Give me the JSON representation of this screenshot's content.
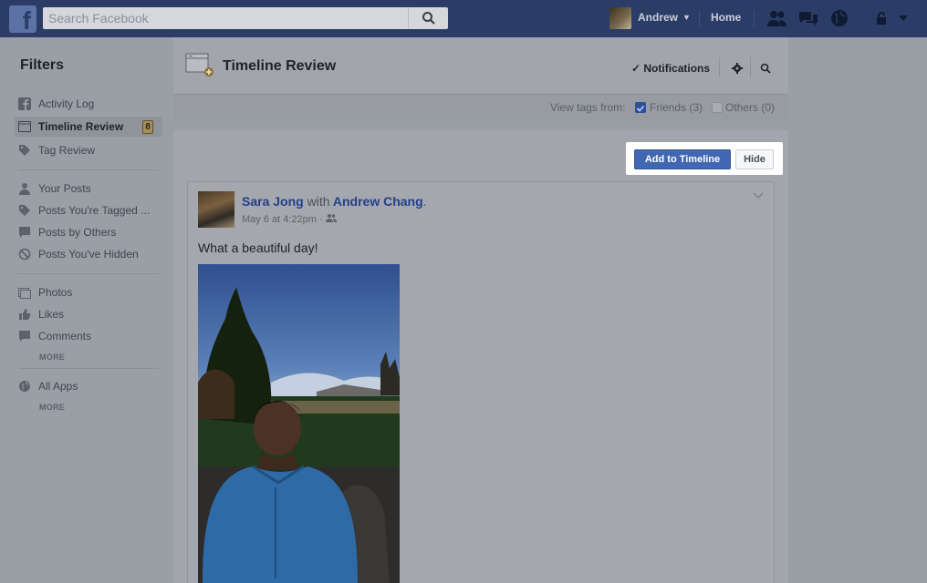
{
  "topbar": {
    "search_placeholder": "Search Facebook",
    "user_name": "Andrew",
    "home_label": "Home"
  },
  "sidebar": {
    "title": "Filters",
    "items": [
      {
        "label": "Activity Log",
        "icon": "fb-square-icon"
      },
      {
        "label": "Timeline Review",
        "icon": "timeline-icon",
        "active": true,
        "badge": "8"
      },
      {
        "label": "Tag Review",
        "icon": "tag-icon"
      },
      {
        "label": "Your Posts",
        "icon": "person-icon"
      },
      {
        "label": "Posts You're Tagged ...",
        "icon": "tag-icon"
      },
      {
        "label": "Posts by Others",
        "icon": "comment-icon"
      },
      {
        "label": "Posts You've Hidden",
        "icon": "hidden-icon"
      },
      {
        "label": "Photos",
        "icon": "photos-icon"
      },
      {
        "label": "Likes",
        "icon": "thumbs-up-icon"
      },
      {
        "label": "Comments",
        "icon": "comment-icon"
      },
      {
        "label": "All Apps",
        "icon": "globe-icon"
      }
    ],
    "more_label_1": "MORE",
    "more_label_2": "MORE"
  },
  "header": {
    "title": "Timeline Review",
    "notifications_label": "Notifications"
  },
  "tags": {
    "label": "View tags from:",
    "friends": "Friends (3)",
    "friends_checked": true,
    "others": "Others (0)",
    "others_checked": false
  },
  "actions": {
    "add_label": "Add to Timeline",
    "hide_label": "Hide"
  },
  "post": {
    "author": "Sara Jong",
    "with_text": "with",
    "tagged": "Andrew Chang",
    "period": ".",
    "date": "May 6 at 4:22pm · ",
    "text": "What a beautiful day!"
  },
  "colors": {
    "topbar": "#2b3d66",
    "accent": "#4267b2",
    "link": "#24408a"
  }
}
